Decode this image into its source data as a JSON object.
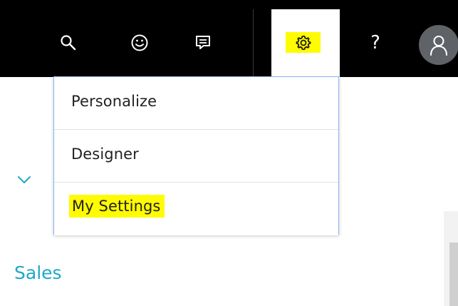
{
  "header": {
    "icons": {
      "search": "search-icon",
      "feedback": "smiley-icon",
      "messages": "chat-icon",
      "settings": "gear-icon",
      "help": "help-icon",
      "avatar": "user-avatar-icon"
    },
    "help_label": "?"
  },
  "menu": {
    "items": [
      {
        "label": "Personalize"
      },
      {
        "label": "Designer"
      },
      {
        "label": "My Settings"
      }
    ]
  },
  "sidebar": {
    "section_label": "Sales",
    "chevron_icon": "chevron-down-icon"
  },
  "colors": {
    "topbar": "#000000",
    "highlight": "#fffb00",
    "link": "#20a7c7",
    "menu_border": "#8ab4f8"
  }
}
